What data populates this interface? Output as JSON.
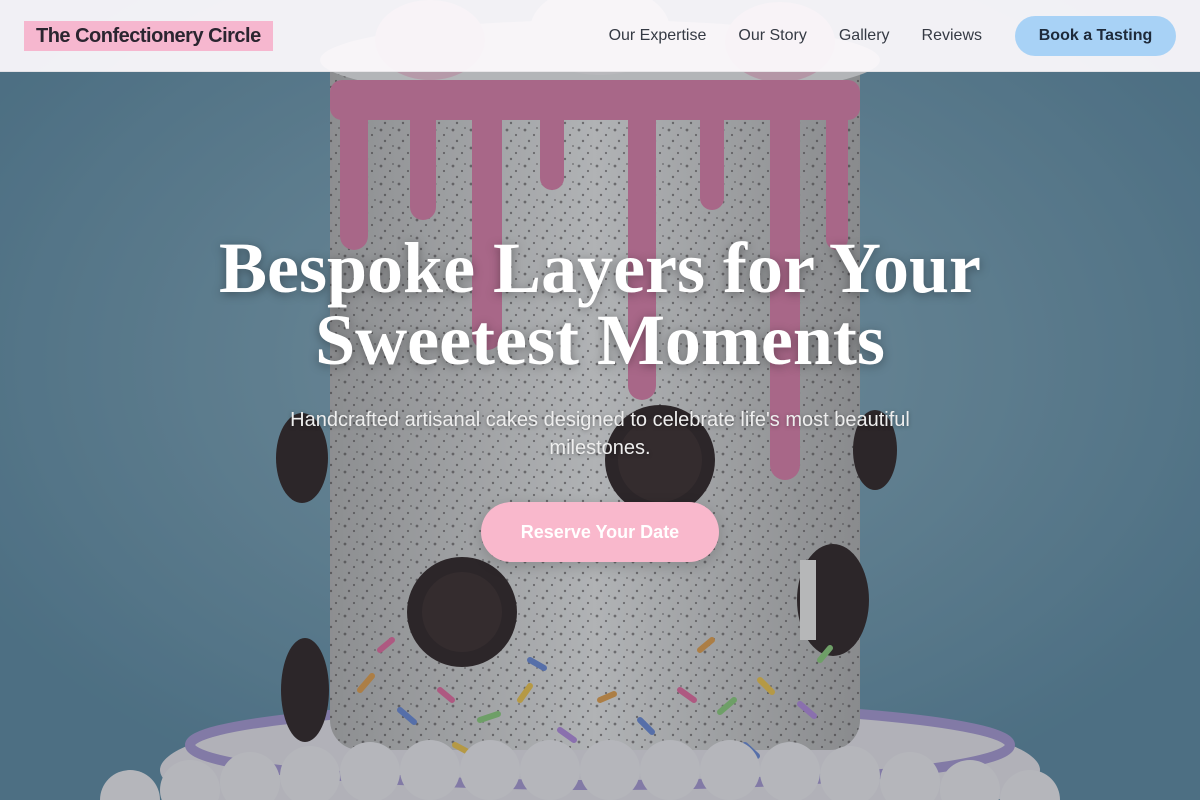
{
  "brand": {
    "name": "The Confectionery Circle"
  },
  "nav": {
    "links": [
      "Our Expertise",
      "Our Story",
      "Gallery",
      "Reviews"
    ],
    "cta_label": "Book a Tasting"
  },
  "hero": {
    "headline_line1": "Bespoke Layers for Your",
    "headline_line2": "Sweetest Moments",
    "subheadline": "Handcrafted artisanal cakes designed to celebrate life's most beautiful milestones.",
    "cta_label": "Reserve Your Date",
    "background_image": "cake-icon"
  },
  "colors": {
    "brand_badge": "#f6b7cf",
    "nav_cta": "#a8d2f6",
    "hero_cta": "#f9b8cc",
    "drip": "#e07fa9"
  }
}
